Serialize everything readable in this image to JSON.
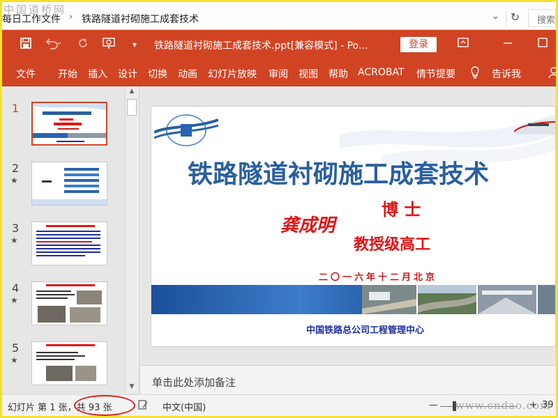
{
  "addressbar": {
    "watermark": "中国道桥网",
    "folder": "每日工作文件",
    "separator": "›",
    "current": "铁路隧道衬砌施工成套技术",
    "dropdown": "⌄",
    "refresh": "↻",
    "search_placeholder": "搜索"
  },
  "titlebar": {
    "title": "铁路隧道衬砌施工成套技术.ppt[兼容模式]  -  Po...",
    "login": "登录",
    "icons": [
      "save-icon",
      "undo-icon",
      "redo-icon",
      "present-icon",
      "customize-icon",
      "ribbon-display-icon",
      "restore-icon"
    ]
  },
  "ribbon": {
    "tabs": [
      "文件",
      "开始",
      "插入",
      "设计",
      "切换",
      "动画",
      "幻灯片放映",
      "审阅",
      "视图",
      "帮助",
      "ACROBAT",
      "情节提要"
    ],
    "tellme": "告诉我"
  },
  "thumbnails": [
    {
      "num": "1",
      "star": "",
      "active": true
    },
    {
      "num": "2",
      "star": "★",
      "active": false
    },
    {
      "num": "3",
      "star": "★",
      "active": false
    },
    {
      "num": "4",
      "star": "★",
      "active": false
    },
    {
      "num": "5",
      "star": "★",
      "active": false
    }
  ],
  "slide": {
    "title": "铁路隧道衬砌施工成套技术",
    "name": "龚成明",
    "degree": "博  士",
    "role": "教授级高工",
    "date": "二〇一六年十二月北京",
    "org": "中国铁路总公司工程管理中心"
  },
  "notes": {
    "placeholder": "单击此处添加备注"
  },
  "status": {
    "slide_of": "幻灯片 第 1 张，共 93 张",
    "language": "中文(中国)",
    "zoom_minus": "—",
    "zoom_plus": "+",
    "zoom_value": "39",
    "watermark": "www.cndao.com"
  },
  "colors": {
    "accent": "#d04424",
    "title_blue": "#2a5f9e",
    "red_text": "#e01515",
    "highlight_border": "#f5e22a"
  }
}
